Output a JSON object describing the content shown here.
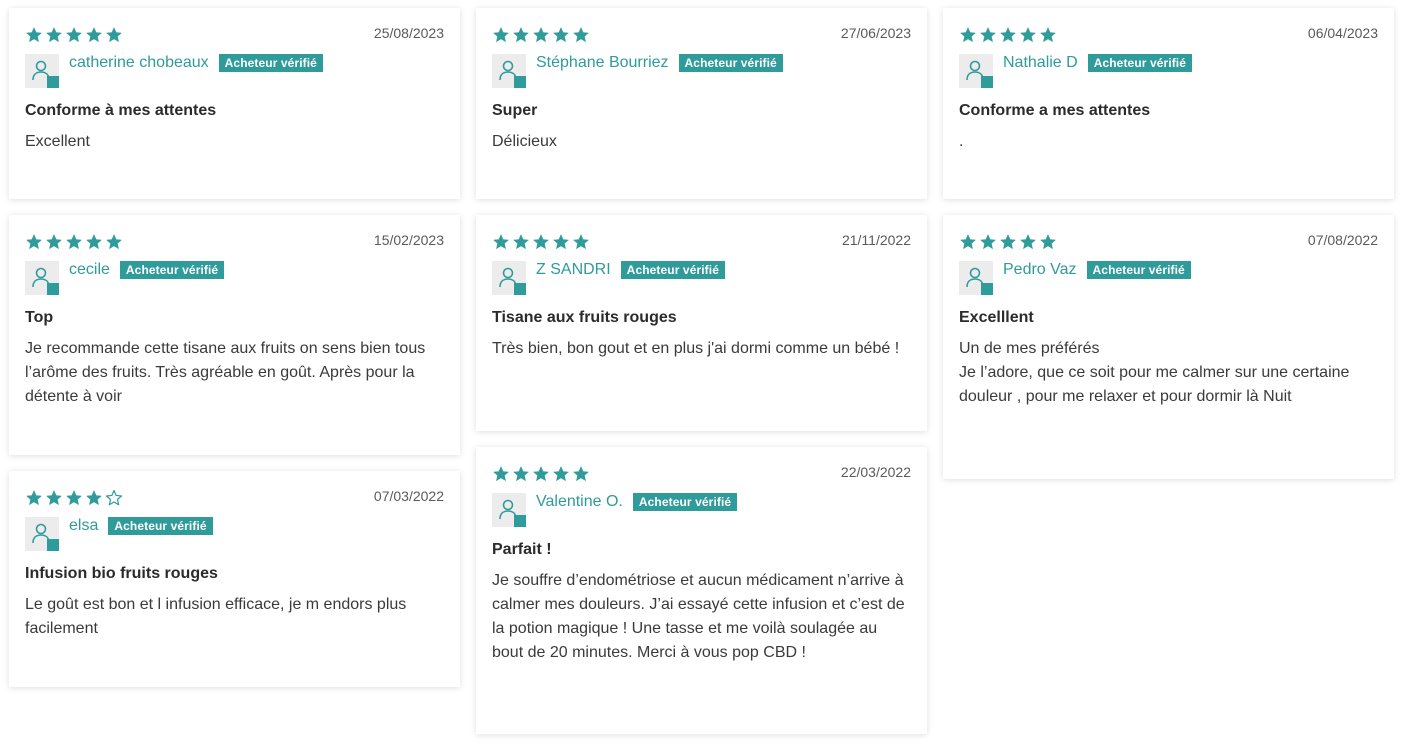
{
  "colors": {
    "accent": "#2f9b9b",
    "star_empty": "#2f9b9b"
  },
  "labels": {
    "verified": "Acheteur vérifié"
  },
  "reviews": [
    {
      "rating": 5,
      "date": "25/08/2023",
      "author": "catherine chobeaux",
      "title": "Conforme à mes attentes",
      "body": "Excellent"
    },
    {
      "rating": 5,
      "date": "27/06/2023",
      "author": "Stéphane Bourriez",
      "title": "Super",
      "body": "Délicieux"
    },
    {
      "rating": 5,
      "date": "06/04/2023",
      "author": "Nathalie D",
      "title": "Conforme a mes attentes",
      "body": "."
    },
    {
      "rating": 5,
      "date": "15/02/2023",
      "author": "cecile",
      "title": "Top",
      "body": "Je recommande cette tisane aux fruits on sens bien tous l’arôme des fruits. Très agréable en goût. Après pour la détente à voir"
    },
    {
      "rating": 5,
      "date": "21/11/2022",
      "author": "Z SANDRI",
      "title": "Tisane aux fruits rouges",
      "body": "Très bien, bon gout et en plus j'ai dormi comme un bébé !"
    },
    {
      "rating": 5,
      "date": "07/08/2022",
      "author": "Pedro Vaz",
      "title": "Excelllent",
      "body": "Un de mes préférés\nJe l’adore, que ce soit pour me calmer sur une certaine douleur , pour me relaxer et pour dormir là Nuit"
    },
    {
      "rating": 4,
      "date": "07/03/2022",
      "author": "elsa",
      "title": "Infusion bio fruits rouges",
      "body": "Le goût est bon et l infusion efficace, je m endors plus facilement"
    },
    {
      "rating": 5,
      "date": "22/03/2022",
      "author": "Valentine O.",
      "title": "Parfait !",
      "body": "Je souffre d’endométriose et aucun médicament n’arrive à calmer mes douleurs. J’ai essayé cette infusion et c’est de la potion magique ! Une tasse et me voilà soulagée au bout de 20 minutes. Merci à vous pop CBD !"
    }
  ]
}
